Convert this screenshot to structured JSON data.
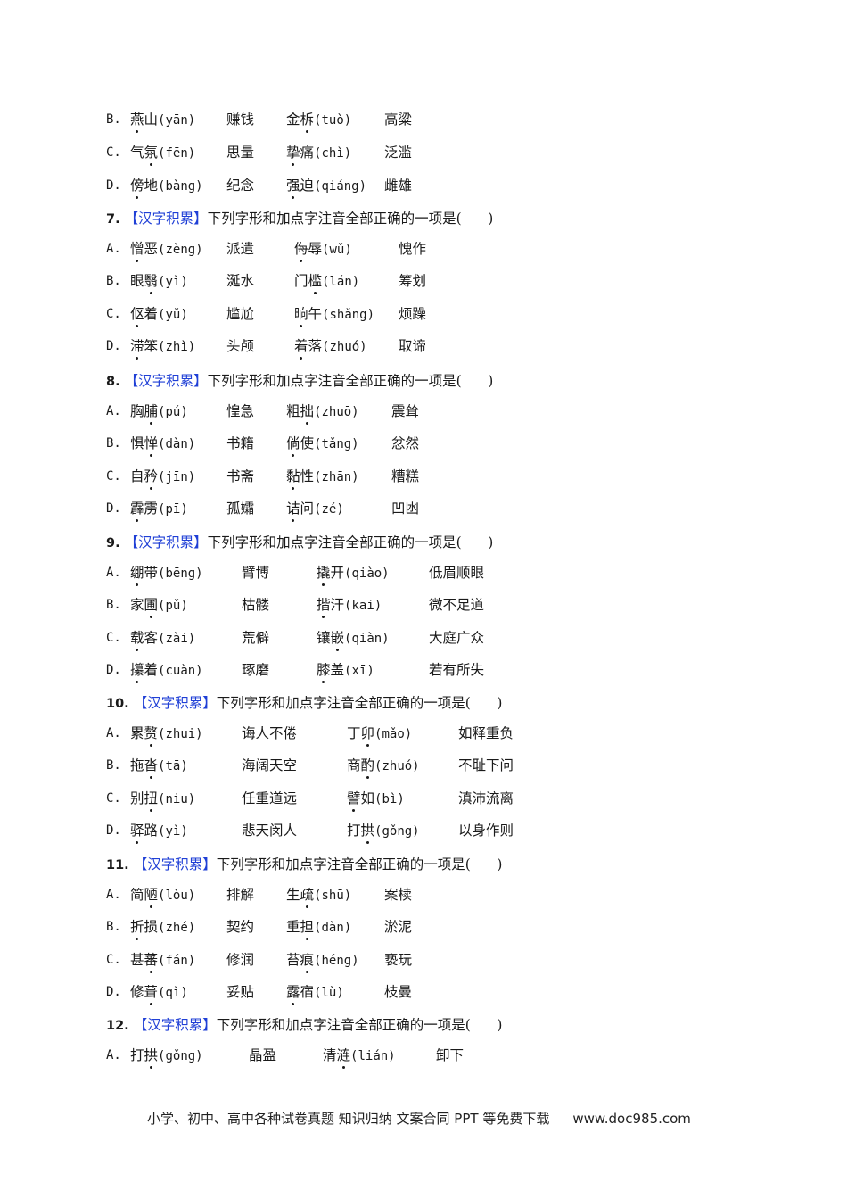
{
  "document": {
    "question_tag": "【汉字积累】",
    "question_stem": "下列字形和加点字注音全部正确的一项是(",
    "answer_blank": "        )",
    "partial_question": {
      "options": [
        {
          "letter": "B.",
          "items": [
            {
              "pre": "燕",
              "dot": "",
              "post": "山",
              "dotIdx": 0,
              "py": "(yān)"
            },
            {
              "text": "赚钱"
            },
            {
              "pre": "金",
              "dot": "",
              "post": "柝",
              "dotIdx": 1,
              "py": "(tuò)"
            },
            {
              "text": "高粱"
            }
          ]
        },
        {
          "letter": "C.",
          "items": [
            {
              "pre": "气",
              "dot": "",
              "post": "氛",
              "dotIdx": 1,
              "py": "(fēn)"
            },
            {
              "text": "思量"
            },
            {
              "pre": "挚",
              "dot": "",
              "post": "痛",
              "dotIdx": 0,
              "py": "(chì)"
            },
            {
              "text": "泛滥"
            }
          ]
        },
        {
          "letter": "D.",
          "items": [
            {
              "pre": "傍",
              "dot": "",
              "post": "地",
              "dotIdx": 0,
              "py": "(bàng)"
            },
            {
              "text": "纪念"
            },
            {
              "pre": "强",
              "dot": "",
              "post": "迫",
              "dotIdx": 0,
              "py": "(qiáng)"
            },
            {
              "text": "雌雄"
            }
          ]
        }
      ]
    },
    "questions": [
      {
        "number": "7.",
        "options": [
          {
            "letter": "A.",
            "items": [
              {
                "w": "憎恶",
                "d": 0,
                "py": "(zèng)"
              },
              {
                "text": "派遣"
              },
              {
                "w": "侮辱",
                "d": 0,
                "py": "(wǔ)"
              },
              {
                "text": "愧作"
              }
            ]
          },
          {
            "letter": "B.",
            "items": [
              {
                "w": "眼翳",
                "d": 1,
                "py": "(yì)"
              },
              {
                "text": "涎水"
              },
              {
                "w": "门槛",
                "d": 1,
                "py": "(lán)"
              },
              {
                "text": "筹划"
              }
            ]
          },
          {
            "letter": "C.",
            "items": [
              {
                "w": "伛着",
                "d": 0,
                "py": "(yǔ)"
              },
              {
                "text": "尴尬"
              },
              {
                "w": "晌午",
                "d": 0,
                "py": "(shǎng)"
              },
              {
                "text": "烦躁"
              }
            ]
          },
          {
            "letter": "D.",
            "items": [
              {
                "w": "滞笨",
                "d": 0,
                "py": "(zhì)"
              },
              {
                "text": "头颅"
              },
              {
                "w": "着落",
                "d": 0,
                "py": "(zhuó)"
              },
              {
                "text": "取谛"
              }
            ]
          }
        ]
      },
      {
        "number": "8.",
        "options": [
          {
            "letter": "A.",
            "items": [
              {
                "w": "胸脯",
                "d": 1,
                "py": "(pú)"
              },
              {
                "text": "惶急"
              },
              {
                "w": "粗拙",
                "d": 1,
                "py": "(zhuō)"
              },
              {
                "text": "震耸"
              }
            ]
          },
          {
            "letter": "B.",
            "items": [
              {
                "w": "惧惮",
                "d": 1,
                "py": "(dàn)"
              },
              {
                "text": "书籍"
              },
              {
                "w": "倘使",
                "d": 0,
                "py": "(tǎng)"
              },
              {
                "text": "忿然"
              }
            ]
          },
          {
            "letter": "C.",
            "items": [
              {
                "w": "自矜",
                "d": 1,
                "py": "(jīn)"
              },
              {
                "text": "书斋"
              },
              {
                "w": "黏性",
                "d": 0,
                "py": "(zhān)"
              },
              {
                "text": "糟糕"
              }
            ]
          },
          {
            "letter": "D.",
            "items": [
              {
                "w": "霹雳",
                "d": 0,
                "py": "(pī)"
              },
              {
                "text": "孤孀"
              },
              {
                "w": "诘问",
                "d": 0,
                "py": "(zé)"
              },
              {
                "text": "凹凼"
              }
            ]
          }
        ]
      },
      {
        "number": "9.",
        "options": [
          {
            "letter": "A.",
            "items": [
              {
                "w": "绷带",
                "d": 0,
                "py": "(bēng)"
              },
              {
                "text": "臂博"
              },
              {
                "w": "撬开",
                "d": 0,
                "py": "(qiào)"
              },
              {
                "text": "低眉顺眼"
              }
            ]
          },
          {
            "letter": "B.",
            "items": [
              {
                "w": "家圃",
                "d": 1,
                "py": "(pǔ)"
              },
              {
                "text": "枯髅"
              },
              {
                "w": "揩汗",
                "d": 0,
                "py": "(kāi)"
              },
              {
                "text": "微不足道"
              }
            ]
          },
          {
            "letter": "C.",
            "items": [
              {
                "w": "载客",
                "d": 0,
                "py": "(zài)"
              },
              {
                "text": "荒僻"
              },
              {
                "w": "镶嵌",
                "d": 1,
                "py": "(qiàn)"
              },
              {
                "text": "大庭广众"
              }
            ]
          },
          {
            "letter": "D.",
            "items": [
              {
                "w": "攥着",
                "d": 0,
                "py": "(cuàn)"
              },
              {
                "text": "琢磨"
              },
              {
                "w": "膝盖",
                "d": 0,
                "py": "(xī)"
              },
              {
                "text": "若有所失"
              }
            ]
          }
        ]
      },
      {
        "number": "10.",
        "options": [
          {
            "letter": "A.",
            "items": [
              {
                "w": "累赘",
                "d": 1,
                "py": "(zhui)"
              },
              {
                "text": "诲人不倦"
              },
              {
                "w": "丁卯",
                "d": 1,
                "py": "(mǎo)"
              },
              {
                "text": "如释重负"
              }
            ]
          },
          {
            "letter": "B.",
            "items": [
              {
                "w": "拖沓",
                "d": 1,
                "py": "(tā)"
              },
              {
                "text": "海阔天空"
              },
              {
                "w": "商酌",
                "d": 1,
                "py": "(zhuó)"
              },
              {
                "text": "不耻下问"
              }
            ]
          },
          {
            "letter": "C.",
            "items": [
              {
                "w": "别扭",
                "d": 1,
                "py": "(niu)"
              },
              {
                "text": "任重道远"
              },
              {
                "w": "譬如",
                "d": 0,
                "py": "(bì)"
              },
              {
                "text": "滇沛流离"
              }
            ]
          },
          {
            "letter": "D.",
            "items": [
              {
                "w": "驿路",
                "d": 0,
                "py": "(yì)"
              },
              {
                "text": "悲天闵人"
              },
              {
                "w": "打拱",
                "d": 1,
                "py": "(gǒng)"
              },
              {
                "text": "以身作则"
              }
            ]
          }
        ]
      },
      {
        "number": "11.",
        "options": [
          {
            "letter": "A.",
            "items": [
              {
                "w": "简陋",
                "d": 1,
                "py": "(lòu)"
              },
              {
                "text": "排解"
              },
              {
                "w": "生疏",
                "d": 1,
                "py": "(shū)"
              },
              {
                "text": "案椟"
              }
            ]
          },
          {
            "letter": "B.",
            "items": [
              {
                "w": "折损",
                "d": 0,
                "py": "(zhé)"
              },
              {
                "text": "契约"
              },
              {
                "w": "重担",
                "d": 1,
                "py": "(dàn)"
              },
              {
                "text": "淤泥"
              }
            ]
          },
          {
            "letter": "C.",
            "items": [
              {
                "w": "甚蕃",
                "d": 1,
                "py": "(fán)"
              },
              {
                "text": "修润"
              },
              {
                "w": "苔痕",
                "d": 1,
                "py": "(héng)"
              },
              {
                "text": "亵玩"
              }
            ]
          },
          {
            "letter": "D.",
            "items": [
              {
                "w": "修葺",
                "d": 1,
                "py": "(qì)"
              },
              {
                "text": "妥贴"
              },
              {
                "w": "露宿",
                "d": 0,
                "py": "(lù)"
              },
              {
                "text": "枝曼"
              }
            ]
          }
        ]
      },
      {
        "number": "12.",
        "options": [
          {
            "letter": "A.",
            "items": [
              {
                "w": "打拱",
                "d": 1,
                "py": "(gǒng)"
              },
              {
                "text": "晶盈"
              },
              {
                "w": "清涟",
                "d": 1,
                "py": "(lián)"
              },
              {
                "text": "卸下"
              }
            ]
          }
        ]
      }
    ],
    "footer": {
      "text": "小学、初中、高中各种试卷真题  知识归纳  文案合同  PPT 等免费下载",
      "url": "www.doc985.com"
    }
  },
  "colors": {
    "tag": "#1f3fd6",
    "text": "#1a1a1a"
  }
}
